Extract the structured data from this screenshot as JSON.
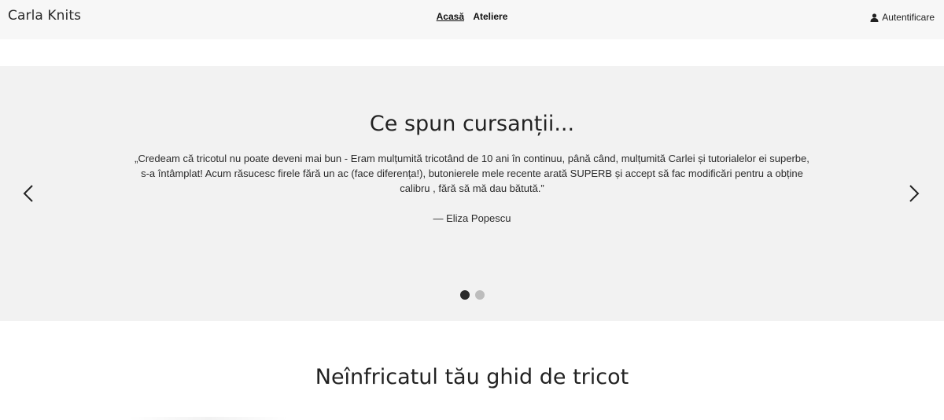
{
  "header": {
    "brand": "Carla Knits",
    "nav": [
      {
        "label": "Acasă",
        "active": true
      },
      {
        "label": "Ateliere",
        "active": false
      }
    ],
    "login_label": "Autentificare",
    "login_icon": "user-icon"
  },
  "testimonials": {
    "title": "Ce spun cursanții...",
    "quote": "„Credeam că tricotul nu poate deveni mai bun - Eram mulțumită tricotând de 10 ani în continuu, până când, mulțumită Carlei și tutorialelor ei superbe, s-a întâmplat! Acum răsucesc firele fără un ac (face diferența!), butonierele mele recente arată SUPERB și accept să fac modificări pentru a obține calibru , fără să mă dau bătută.”",
    "author": "— Eliza Popescu",
    "prev_icon": "chevron-left-icon",
    "next_icon": "chevron-right-icon",
    "slides_total": 2,
    "active_slide": 1
  },
  "guide": {
    "title": "Neînfricatul tău ghid de tricot"
  },
  "colors": {
    "header_bg": "#f7f7f7",
    "section_bg": "#f2f2f2",
    "dot_active": "#2b2b2b",
    "dot_inactive": "#bdbdbd"
  }
}
